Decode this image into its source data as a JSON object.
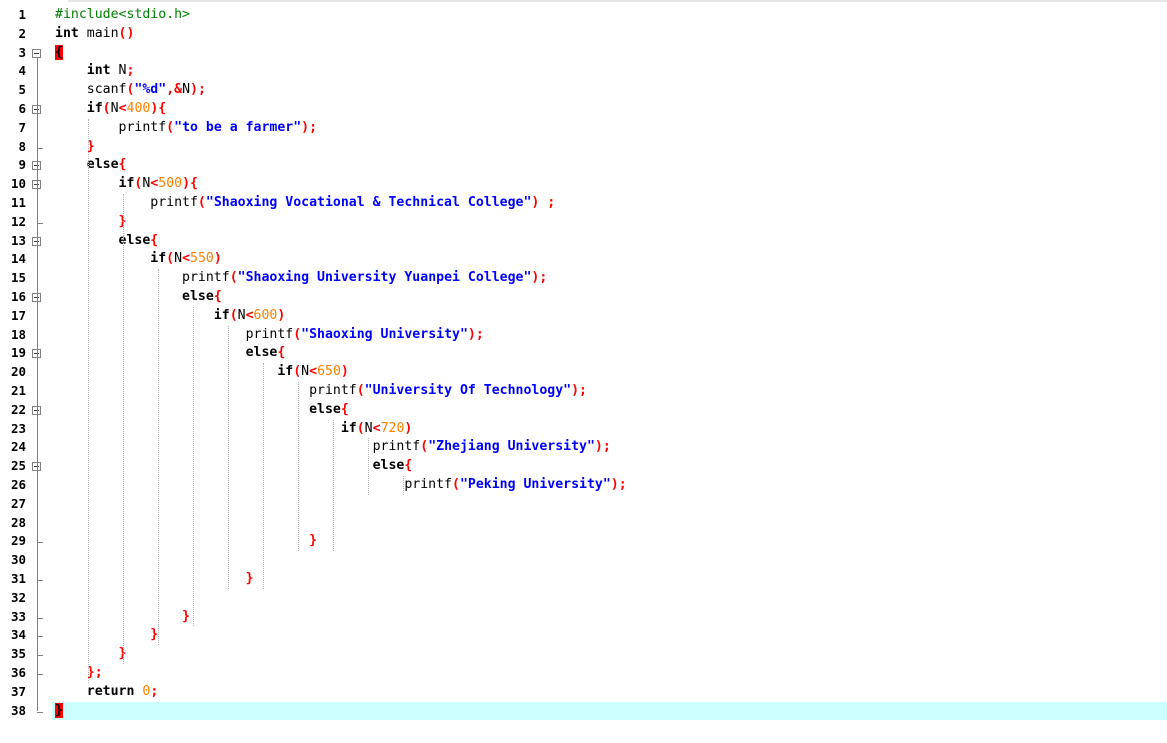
{
  "colors": {
    "keyword": "#000000",
    "identifier": "#000000",
    "operator": "#ff0000",
    "number": "#ff8000",
    "string": "#0000ff",
    "preprocessor": "#008000",
    "current_line_bg": "#ccffff",
    "brace_highlight_bg": "#ff0000"
  },
  "editor": {
    "current_line": 38,
    "lines": [
      {
        "n": "1",
        "tokens": [
          {
            "t": "#include<stdio.h>",
            "c": "preprocessor"
          }
        ]
      },
      {
        "n": "2",
        "tokens": [
          {
            "t": "int",
            "c": "keyword"
          },
          {
            "t": " main",
            "c": "identifier"
          },
          {
            "t": "()",
            "c": "operator"
          }
        ]
      },
      {
        "n": "3",
        "fold": "open",
        "tokens": [
          {
            "t": "{",
            "c": "brace_hl"
          }
        ]
      },
      {
        "n": "4",
        "fold": "mid",
        "tokens": [
          {
            "t": "    "
          },
          {
            "t": "int",
            "c": "keyword"
          },
          {
            "t": " N",
            "c": "identifier"
          },
          {
            "t": ";",
            "c": "operator"
          }
        ]
      },
      {
        "n": "5",
        "fold": "mid",
        "tokens": [
          {
            "t": "    "
          },
          {
            "t": "scanf",
            "c": "identifier"
          },
          {
            "t": "(",
            "c": "operator"
          },
          {
            "t": "\"%d\"",
            "c": "string"
          },
          {
            "t": ",&",
            "c": "operator"
          },
          {
            "t": "N",
            "c": "identifier"
          },
          {
            "t": ");",
            "c": "operator"
          }
        ]
      },
      {
        "n": "6",
        "fold": "open",
        "tokens": [
          {
            "t": "    "
          },
          {
            "t": "if",
            "c": "keyword"
          },
          {
            "t": "(",
            "c": "operator"
          },
          {
            "t": "N",
            "c": "identifier"
          },
          {
            "t": "<",
            "c": "operator"
          },
          {
            "t": "400",
            "c": "number"
          },
          {
            "t": "){",
            "c": "operator"
          }
        ]
      },
      {
        "n": "7",
        "fold": "mid",
        "tokens": [
          {
            "t": "        "
          },
          {
            "t": "printf",
            "c": "identifier"
          },
          {
            "t": "(",
            "c": "operator"
          },
          {
            "t": "\"to be a farmer\"",
            "c": "string"
          },
          {
            "t": ");",
            "c": "operator"
          }
        ]
      },
      {
        "n": "8",
        "fold": "end",
        "tokens": [
          {
            "t": "    "
          },
          {
            "t": "}",
            "c": "operator"
          }
        ]
      },
      {
        "n": "9",
        "fold": "open",
        "tokens": [
          {
            "t": "    "
          },
          {
            "t": "else",
            "c": "keyword"
          },
          {
            "t": "{",
            "c": "operator"
          }
        ]
      },
      {
        "n": "10",
        "fold": "open",
        "tokens": [
          {
            "t": "        "
          },
          {
            "t": "if",
            "c": "keyword"
          },
          {
            "t": "(",
            "c": "operator"
          },
          {
            "t": "N",
            "c": "identifier"
          },
          {
            "t": "<",
            "c": "operator"
          },
          {
            "t": "500",
            "c": "number"
          },
          {
            "t": "){",
            "c": "operator"
          }
        ]
      },
      {
        "n": "11",
        "fold": "mid",
        "tokens": [
          {
            "t": "            "
          },
          {
            "t": "printf",
            "c": "identifier"
          },
          {
            "t": "(",
            "c": "operator"
          },
          {
            "t": "\"Shaoxing Vocational & Technical College\"",
            "c": "string"
          },
          {
            "t": ") ;",
            "c": "operator"
          }
        ]
      },
      {
        "n": "12",
        "fold": "end",
        "tokens": [
          {
            "t": "        "
          },
          {
            "t": "}",
            "c": "operator"
          }
        ]
      },
      {
        "n": "13",
        "fold": "open",
        "tokens": [
          {
            "t": "        "
          },
          {
            "t": "else",
            "c": "keyword"
          },
          {
            "t": "{",
            "c": "operator"
          }
        ]
      },
      {
        "n": "14",
        "fold": "mid",
        "tokens": [
          {
            "t": "            "
          },
          {
            "t": "if",
            "c": "keyword"
          },
          {
            "t": "(",
            "c": "operator"
          },
          {
            "t": "N",
            "c": "identifier"
          },
          {
            "t": "<",
            "c": "operator"
          },
          {
            "t": "550",
            "c": "number"
          },
          {
            "t": ")",
            "c": "operator"
          }
        ]
      },
      {
        "n": "15",
        "fold": "mid",
        "tokens": [
          {
            "t": "                "
          },
          {
            "t": "printf",
            "c": "identifier"
          },
          {
            "t": "(",
            "c": "operator"
          },
          {
            "t": "\"Shaoxing University Yuanpei College\"",
            "c": "string"
          },
          {
            "t": ");",
            "c": "operator"
          }
        ]
      },
      {
        "n": "16",
        "fold": "open",
        "tokens": [
          {
            "t": "                "
          },
          {
            "t": "else",
            "c": "keyword"
          },
          {
            "t": "{",
            "c": "operator"
          }
        ]
      },
      {
        "n": "17",
        "fold": "mid",
        "tokens": [
          {
            "t": "                    "
          },
          {
            "t": "if",
            "c": "keyword"
          },
          {
            "t": "(",
            "c": "operator"
          },
          {
            "t": "N",
            "c": "identifier"
          },
          {
            "t": "<",
            "c": "operator"
          },
          {
            "t": "600",
            "c": "number"
          },
          {
            "t": ")",
            "c": "operator"
          }
        ]
      },
      {
        "n": "18",
        "fold": "mid",
        "tokens": [
          {
            "t": "                        "
          },
          {
            "t": "printf",
            "c": "identifier"
          },
          {
            "t": "(",
            "c": "operator"
          },
          {
            "t": "\"Shaoxing University\"",
            "c": "string"
          },
          {
            "t": ");",
            "c": "operator"
          }
        ]
      },
      {
        "n": "19",
        "fold": "open",
        "tokens": [
          {
            "t": "                        "
          },
          {
            "t": "else",
            "c": "keyword"
          },
          {
            "t": "{",
            "c": "operator"
          }
        ]
      },
      {
        "n": "20",
        "fold": "mid",
        "tokens": [
          {
            "t": "                            "
          },
          {
            "t": "if",
            "c": "keyword"
          },
          {
            "t": "(",
            "c": "operator"
          },
          {
            "t": "N",
            "c": "identifier"
          },
          {
            "t": "<",
            "c": "operator"
          },
          {
            "t": "650",
            "c": "number"
          },
          {
            "t": ")",
            "c": "operator"
          }
        ]
      },
      {
        "n": "21",
        "fold": "mid",
        "tokens": [
          {
            "t": "                                "
          },
          {
            "t": "printf",
            "c": "identifier"
          },
          {
            "t": "(",
            "c": "operator"
          },
          {
            "t": "\"University Of Technology\"",
            "c": "string"
          },
          {
            "t": ");",
            "c": "operator"
          }
        ]
      },
      {
        "n": "22",
        "fold": "open",
        "tokens": [
          {
            "t": "                                "
          },
          {
            "t": "else",
            "c": "keyword"
          },
          {
            "t": "{",
            "c": "operator"
          }
        ]
      },
      {
        "n": "23",
        "fold": "mid",
        "tokens": [
          {
            "t": "                                    "
          },
          {
            "t": "if",
            "c": "keyword"
          },
          {
            "t": "(",
            "c": "operator"
          },
          {
            "t": "N",
            "c": "identifier"
          },
          {
            "t": "<",
            "c": "operator"
          },
          {
            "t": "720",
            "c": "number"
          },
          {
            "t": ")",
            "c": "operator"
          }
        ]
      },
      {
        "n": "24",
        "fold": "mid",
        "tokens": [
          {
            "t": "                                        "
          },
          {
            "t": "printf",
            "c": "identifier"
          },
          {
            "t": "(",
            "c": "operator"
          },
          {
            "t": "\"Zhejiang University\"",
            "c": "string"
          },
          {
            "t": ");",
            "c": "operator"
          }
        ]
      },
      {
        "n": "25",
        "fold": "open",
        "tokens": [
          {
            "t": "                                        "
          },
          {
            "t": "else",
            "c": "keyword"
          },
          {
            "t": "{",
            "c": "operator"
          }
        ]
      },
      {
        "n": "26",
        "fold": "mid",
        "tokens": [
          {
            "t": "                                            "
          },
          {
            "t": "printf",
            "c": "identifier"
          },
          {
            "t": "(",
            "c": "operator"
          },
          {
            "t": "\"Peking University\"",
            "c": "string"
          },
          {
            "t": ");",
            "c": "operator"
          }
        ]
      },
      {
        "n": "27",
        "fold": "mid",
        "tokens": []
      },
      {
        "n": "28",
        "fold": "mid",
        "tokens": []
      },
      {
        "n": "29",
        "fold": "end",
        "tokens": [
          {
            "t": "                                "
          },
          {
            "t": "}",
            "c": "operator"
          }
        ]
      },
      {
        "n": "30",
        "fold": "mid",
        "tokens": []
      },
      {
        "n": "31",
        "fold": "end",
        "tokens": [
          {
            "t": "                        "
          },
          {
            "t": "}",
            "c": "operator"
          }
        ]
      },
      {
        "n": "32",
        "fold": "mid",
        "tokens": []
      },
      {
        "n": "33",
        "fold": "end",
        "tokens": [
          {
            "t": "                "
          },
          {
            "t": "}",
            "c": "operator"
          }
        ]
      },
      {
        "n": "34",
        "fold": "end",
        "tokens": [
          {
            "t": "            "
          },
          {
            "t": "}",
            "c": "operator"
          }
        ]
      },
      {
        "n": "35",
        "fold": "end",
        "tokens": [
          {
            "t": "        "
          },
          {
            "t": "}",
            "c": "operator"
          }
        ]
      },
      {
        "n": "36",
        "fold": "end",
        "tokens": [
          {
            "t": "    "
          },
          {
            "t": "};",
            "c": "operator"
          }
        ]
      },
      {
        "n": "37",
        "fold": "mid",
        "tokens": [
          {
            "t": "    "
          },
          {
            "t": "return",
            "c": "keyword"
          },
          {
            "t": " ",
            "c": "identifier"
          },
          {
            "t": "0",
            "c": "number"
          },
          {
            "t": ";",
            "c": "operator"
          }
        ]
      },
      {
        "n": "38",
        "fold": "last",
        "tokens": [
          {
            "t": "}",
            "c": "brace_hl"
          }
        ]
      }
    ]
  }
}
